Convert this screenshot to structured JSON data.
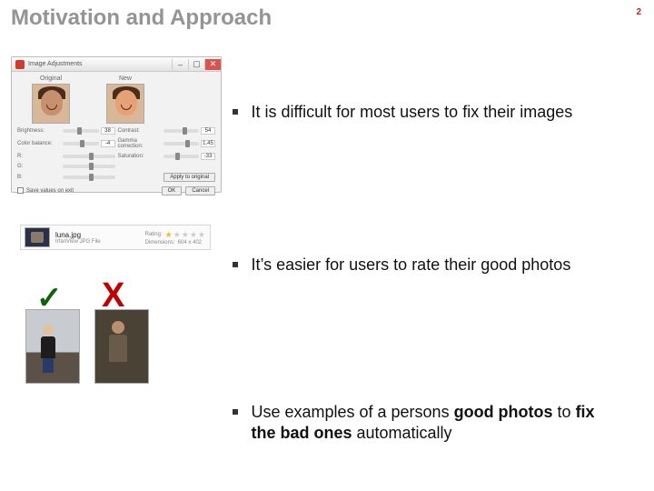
{
  "title": "Motivation and Approach",
  "page_number": "2",
  "bullets": {
    "b1": "It is difficult for most users to fix their images",
    "b2": "It’s easier for users to rate their good photos",
    "b3_pre": "Use examples of a persons ",
    "b3_bold1": "good photos",
    "b3_mid": " to ",
    "b3_bold2": "fix the bad ones",
    "b3_post": " automatically"
  },
  "editor": {
    "window_title": "Image Adjustments",
    "preview_original": "Original",
    "preview_new": "New",
    "sliders": {
      "brightness_label": "Brightness:",
      "brightness_val": "38",
      "contrast_label": "Contrast:",
      "contrast_val": "54",
      "colorbal_label": "Color balance:",
      "colorbal_val": "-4",
      "gamma_label": "Gamma correction:",
      "gamma_val": "1.45",
      "sat_label": "Saturation:",
      "sat_val": "-33",
      "r_label": "R:",
      "g_label": "G:",
      "b_label": "B:"
    },
    "checkbox": "Save values on exit",
    "apply_btn": "Apply to original",
    "ok_btn": "OK",
    "cancel_btn": "Cancel"
  },
  "rating": {
    "filename": "luna.jpg",
    "filetype": "IrfanView JPG File",
    "rating_label": "Rating:",
    "dimensions_label": "Dimensions:",
    "dimensions_value": "604 x 402"
  },
  "marks": {
    "check": "✓",
    "cross": "X"
  }
}
